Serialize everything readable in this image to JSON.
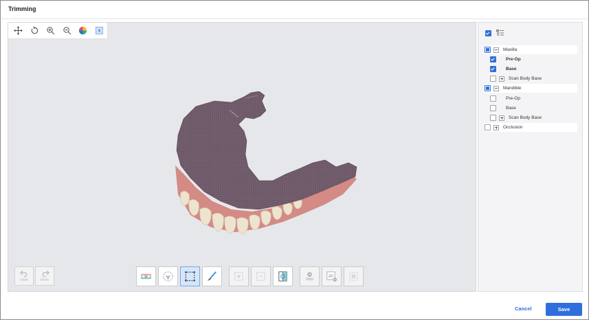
{
  "window": {
    "title": "Trimming"
  },
  "view_toolbar": {
    "tools": [
      {
        "name": "pan-icon"
      },
      {
        "name": "rotate-icon"
      },
      {
        "name": "zoom-in-icon"
      },
      {
        "name": "zoom-out-icon"
      },
      {
        "name": "color-map-icon"
      },
      {
        "name": "texture-toggle-icon"
      }
    ]
  },
  "history": {
    "undo_label": "Undo",
    "redo_label": "Redo"
  },
  "trim_tools": {
    "active": "freeform-area-select",
    "all_label": "All",
    "tools": [
      "occlusion-view",
      "mirror-select",
      "freeform-area-select",
      "brush",
      "fill-area",
      "deselect-area",
      "invert-selection",
      "clear-selection",
      "select-all",
      "delete-selection"
    ]
  },
  "tree": {
    "header_checked": true,
    "items": [
      {
        "label": "Maxilla",
        "state": "partial",
        "expand": "minus",
        "level": 0
      },
      {
        "label": "Pre-Op",
        "state": "checked",
        "level": 1,
        "bold": true
      },
      {
        "label": "Base",
        "state": "checked",
        "level": 1,
        "bold": true
      },
      {
        "label": "Scan Body Base",
        "state": "unchecked",
        "expand": "plus",
        "level": 1
      },
      {
        "label": "Mandible",
        "state": "partial",
        "expand": "minus",
        "level": 0
      },
      {
        "label": "Pre-Op",
        "state": "unchecked",
        "level": 1
      },
      {
        "label": "Base",
        "state": "unchecked",
        "level": 1
      },
      {
        "label": "Scan Body Base",
        "state": "unchecked",
        "expand": "plus",
        "level": 1
      },
      {
        "label": "Occlusion",
        "state": "unchecked",
        "expand": "plus",
        "level": 0
      }
    ]
  },
  "footer": {
    "cancel_label": "Cancel",
    "save_label": "Save"
  },
  "colors": {
    "accent": "#2f6fdb",
    "viewport_bg": "#e6e7ea",
    "scan_tissue": "#6b5564",
    "gum": "#d98c86",
    "tooth": "#ece3cf"
  }
}
